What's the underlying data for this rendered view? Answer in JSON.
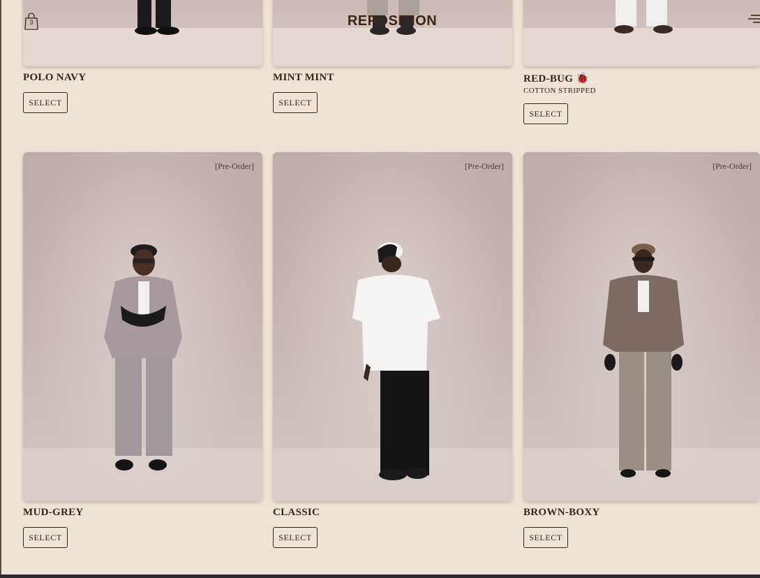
{
  "header": {
    "brand": "REPOSITION",
    "cart_count": "3"
  },
  "top_row": [
    {
      "name": "POLO NAVY",
      "subtitle": "",
      "button": "SELECT"
    },
    {
      "name": "MINT MINT",
      "subtitle": "",
      "button": "SELECT"
    },
    {
      "name": "RED-BUG 🐞",
      "subtitle": "COTTON STRIPPED",
      "button": "SELECT"
    }
  ],
  "products": [
    {
      "badge": "[Pre-Order]",
      "name": "MUD-GREY",
      "button": "SELECT"
    },
    {
      "badge": "[Pre-Order]",
      "name": "CLASSIC",
      "button": "SELECT"
    },
    {
      "badge": "[Pre-Order]",
      "name": "BROWN-BOXY",
      "button": "SELECT"
    }
  ],
  "colors": {
    "background": "#efe3d7",
    "text": "#3a2418",
    "photo_backdrop": "#cdbcb8"
  },
  "icons": [
    "shopping-bag-icon",
    "hamburger-menu-icon"
  ]
}
